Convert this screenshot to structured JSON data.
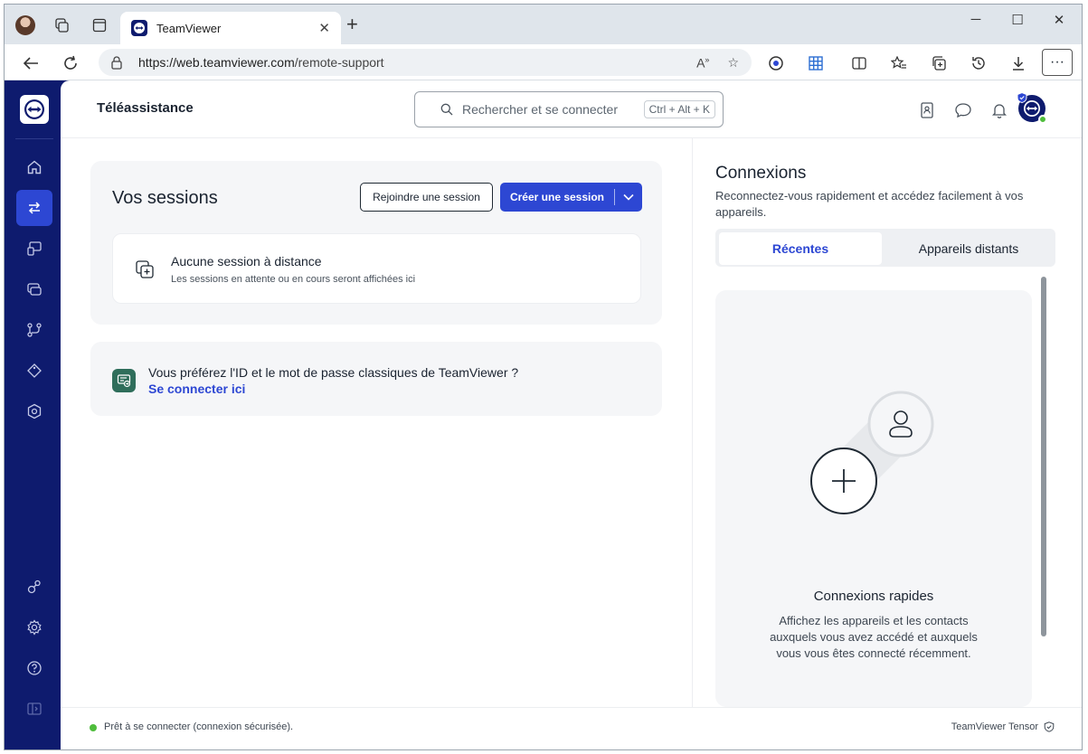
{
  "browser": {
    "tab_title": "TeamViewer",
    "tab_close": "✕",
    "new_tab": "+",
    "url_domain": "https://web.teamviewer.com",
    "url_path": "/remote-support",
    "window_controls": {
      "minimize": "─",
      "maximize": "☐",
      "close": "✕"
    },
    "more_label": "···"
  },
  "topbar": {
    "title": "Téléassistance",
    "search_placeholder": "Rechercher et se connecter",
    "search_shortcut": "Ctrl + Alt + K"
  },
  "sessions": {
    "title": "Vos sessions",
    "join_label": "Rejoindre une session",
    "create_label": "Créer une session",
    "empty_title": "Aucune session à distance",
    "empty_subtitle": "Les sessions en attente ou en cours seront affichées ici"
  },
  "classic": {
    "text": "Vous préférez l'ID et le mot de passe classiques de TeamViewer ?",
    "link": "Se connecter ici"
  },
  "connections": {
    "title": "Connexions",
    "subtitle": "Reconnectez-vous rapidement et accédez facilement à vos appareils.",
    "tabs": [
      {
        "label": "Récentes",
        "active": true
      },
      {
        "label": "Appareils distants",
        "active": false
      }
    ],
    "quick_title": "Connexions rapides",
    "quick_text": "Affichez les appareils et les contacts auxquels vous avez accédé et auxquels vous vous êtes connecté récemment."
  },
  "status": {
    "text": "Prêt à se connecter (connexion sécurisée).",
    "right_text": "TeamViewer Tensor",
    "dot_color": "#4fbd3c"
  },
  "colors": {
    "brand_navy": "#0e1b6e",
    "accent_blue": "#2d47d3",
    "status_green": "#4fbd3c"
  },
  "icons": {
    "sidebar": [
      "home-icon",
      "remote-support-icon",
      "devices-icon",
      "sessions-icon",
      "workflow-icon",
      "tag-icon",
      "security-icon",
      "integrations-icon",
      "settings-icon",
      "help-icon",
      "collapse-icon"
    ],
    "top": [
      "contacts-icon",
      "chat-icon",
      "notifications-icon"
    ]
  }
}
